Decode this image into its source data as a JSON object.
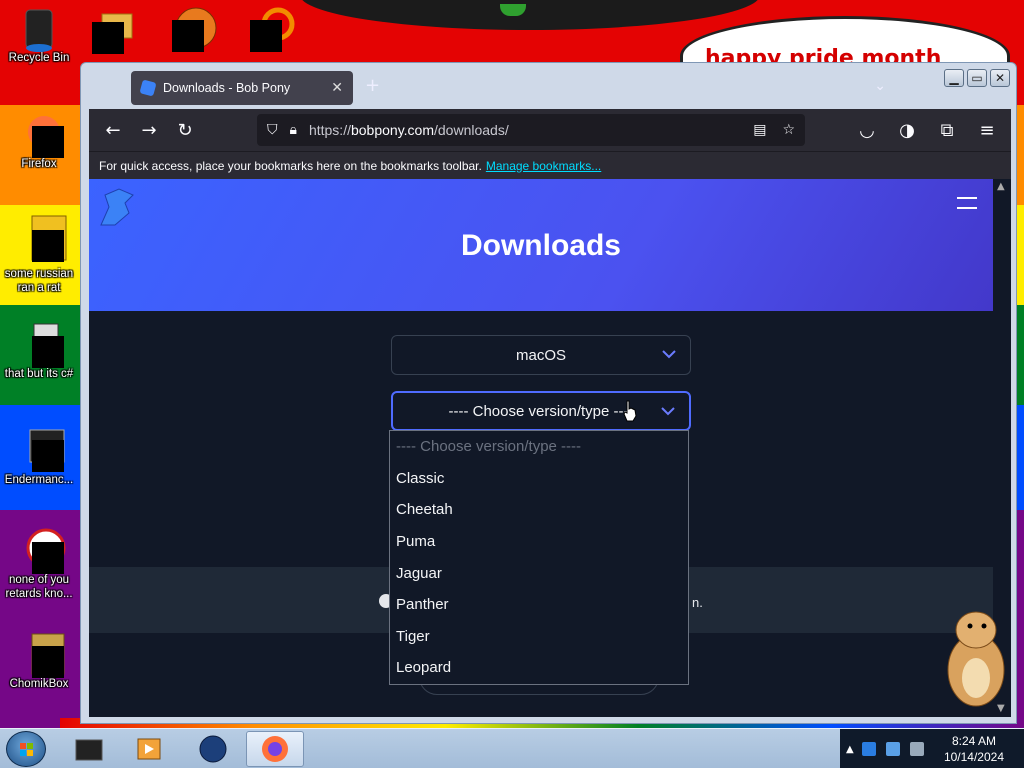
{
  "desktop": {
    "cloud_text": "happy pride month",
    "icons": [
      {
        "label": "Recycle Bin"
      },
      {
        "label": "Firefox"
      },
      {
        "label": "some russian ran a rat"
      },
      {
        "label": "that but its c#"
      },
      {
        "label": "Endermanc..."
      },
      {
        "label": "none of you retards kno..."
      },
      {
        "label": "ChomikBox"
      }
    ]
  },
  "browser": {
    "tab_title": "Downloads - Bob Pony",
    "new_tab_label": "+",
    "url_prefix": "https://",
    "url_host": "bobpony.com",
    "url_path": "/downloads/",
    "bookmarks_text": "For quick access, place your bookmarks here on the bookmarks toolbar.",
    "bookmarks_link": "Manage bookmarks...",
    "window_controls": {
      "minimize": "▁",
      "maximize": "▭",
      "close": "✕"
    }
  },
  "page": {
    "title": "Downloads",
    "os_select_value": "macOS",
    "version_select_value": "---- Choose version/type ----",
    "footer_suffix": "n.",
    "dropdown_options": [
      "---- Choose version/type ----",
      "Classic",
      "Cheetah",
      "Puma",
      "Jaguar",
      "Panther",
      "Tiger",
      "Leopard"
    ]
  },
  "taskbar": {
    "time": "8:24 AM",
    "date": "10/14/2024"
  },
  "colors": {
    "accent": "#4f6bff",
    "page_bg": "#111827",
    "hero_start": "#3b63ff",
    "hero_end": "#4338ca"
  }
}
